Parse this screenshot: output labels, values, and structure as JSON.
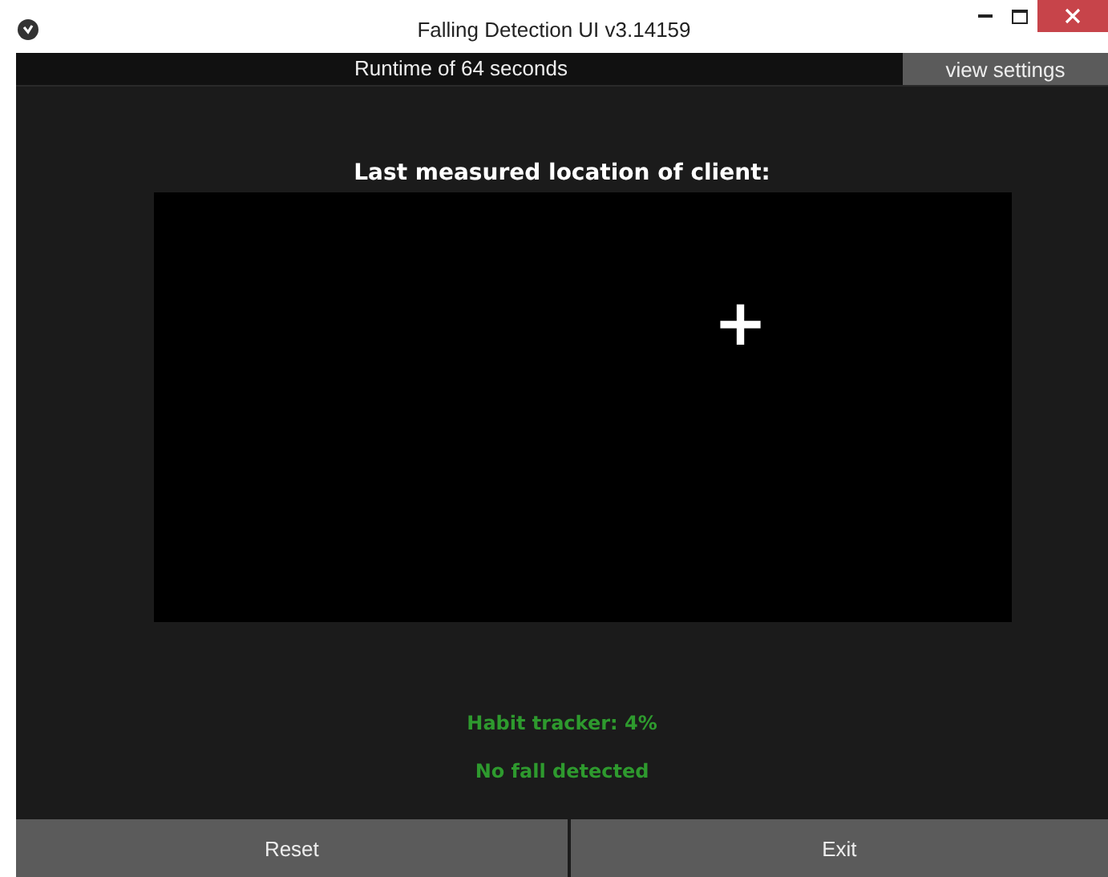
{
  "window": {
    "title": "Falling Detection UI v3.14159"
  },
  "top_bar": {
    "runtime": "Runtime of 64 seconds",
    "settings_button": "view settings"
  },
  "location": {
    "heading": "Last measured location of client:",
    "marker": "+"
  },
  "status": [
    "Habit tracker: 4%",
    "No fall detected"
  ],
  "buttons": [
    "Reset",
    "Exit"
  ]
}
